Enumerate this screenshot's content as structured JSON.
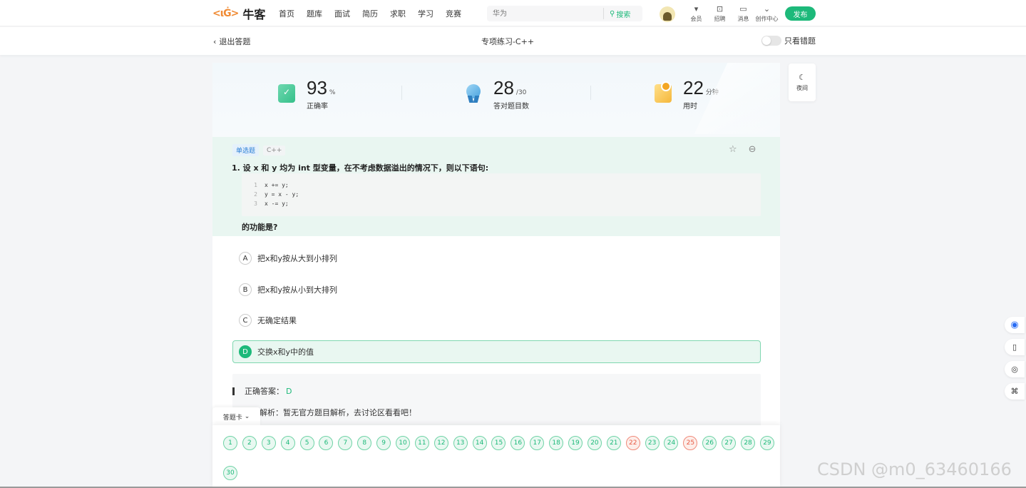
{
  "nav": {
    "logo_mark": "<ιĠ>",
    "logo_name": "牛客",
    "items": [
      "首页",
      "题库",
      "面试",
      "简历",
      "求职",
      "学习",
      "竞赛"
    ],
    "search_placeholder": "华为",
    "search_button": "搜索",
    "icons": [
      {
        "icon": "vip-icon",
        "label": "会员"
      },
      {
        "icon": "recruit-icon",
        "label": "招聘"
      },
      {
        "icon": "message-icon",
        "label": "消息"
      },
      {
        "icon": "creator-icon",
        "label": "创作中心"
      }
    ],
    "publish": "发布"
  },
  "subheader": {
    "exit": "退出答题",
    "title": "专项练习-C++",
    "toggle_label": "只看错题"
  },
  "stats": {
    "accuracy": {
      "value": "93",
      "unit": "%",
      "label": "正确率"
    },
    "correct": {
      "value": "28",
      "unit": "/30",
      "label": "答对题目数"
    },
    "time": {
      "value": "22",
      "unit": "分钟",
      "label": "用时"
    }
  },
  "question": {
    "type_tag": "单选题",
    "lang_tag": "C++",
    "text": "1. 设 x 和 y 均为 int 型变量，在不考虑数据溢出的情况下，则以下语句:",
    "code": [
      {
        "n": "1",
        "line": "x += y;"
      },
      {
        "n": "2",
        "line": "y = x - y;"
      },
      {
        "n": "3",
        "line": "x -= y;"
      }
    ],
    "text2": "的功能是?"
  },
  "options": [
    {
      "letter": "A",
      "text": "把x和y按从大到小排列"
    },
    {
      "letter": "B",
      "text": "把x和y按从小到大排列"
    },
    {
      "letter": "C",
      "text": "无确定结果"
    },
    {
      "letter": "D",
      "text": "交换x和y中的值"
    }
  ],
  "answer": {
    "label": "正确答案：",
    "value": "D",
    "analysis": "解析：暂无官方题目解析，去讨论区看看吧！"
  },
  "answer_card": {
    "tab": "答题卡",
    "numbers": [
      "1",
      "2",
      "3",
      "4",
      "5",
      "6",
      "7",
      "8",
      "9",
      "10",
      "11",
      "12",
      "13",
      "14",
      "15",
      "16",
      "17",
      "18",
      "19",
      "20",
      "21",
      "22",
      "23",
      "24",
      "25",
      "26",
      "27",
      "28",
      "29",
      "30"
    ],
    "wrong": [
      "22",
      "25"
    ]
  },
  "night_mode": {
    "label": "夜间"
  },
  "watermark": "CSDN @m0_63460166",
  "colors": {
    "accent": "#1db97a",
    "wrong": "#e85a44",
    "link": "#2b7fd6"
  }
}
